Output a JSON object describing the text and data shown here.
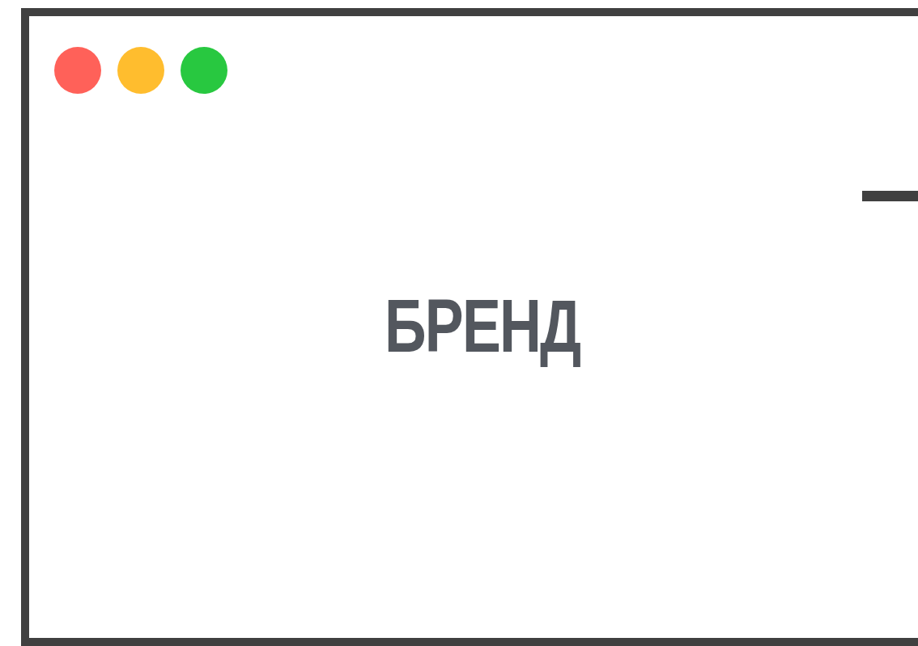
{
  "window": {
    "controls": [
      {
        "color": "#ff6159"
      },
      {
        "color": "#ffbd2e"
      },
      {
        "color": "#28c840"
      }
    ]
  },
  "brand": "БРЕНД"
}
